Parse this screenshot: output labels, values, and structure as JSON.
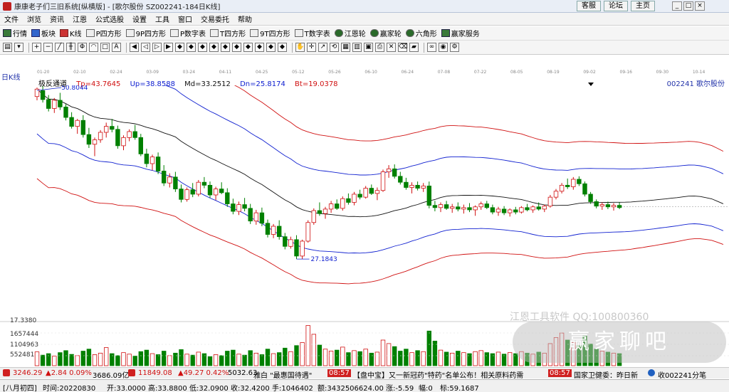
{
  "window": {
    "title": "康康老子们三旧系统[纵横版] - [歌尔股份  SZ002241-184日K线]"
  },
  "title_buttons": {
    "service": "客服",
    "forum": "论坛",
    "home": "主页"
  },
  "menu": [
    "文件",
    "浏览",
    "资讯",
    "江恩",
    "公式选股",
    "设置",
    "工具",
    "窗口",
    "交易委托",
    "帮助"
  ],
  "toolbar": [
    "行情",
    "板块",
    "K线",
    "P四方形",
    "9P四方形",
    "P数字表",
    "T四方形",
    "9T四方形",
    "T数字表",
    "江恩轮",
    "赢家轮",
    "六角形",
    "赢家服务"
  ],
  "chart_header": {
    "period": "日K线",
    "indicator_name": "极反通道",
    "tp": "Tp=43.7645",
    "up": "Up=38.8588",
    "md": "Md=33.2512",
    "dn": "Dn=25.8174",
    "bt": "Bt=19.0378",
    "stock": "002241  歌尔股份"
  },
  "date_axis": [
    "01-20",
    "02-10",
    "02-24",
    "03-09",
    "03-24",
    "04-11",
    "04-25",
    "05-12",
    "05-26",
    "06-10",
    "06-24",
    "07-08",
    "07-22",
    "08-05",
    "08-19",
    "09-02",
    "09-16",
    "09-30",
    "10-14"
  ],
  "volume_axis": [
    "17.3380",
    "1657444",
    "1104963",
    "552481"
  ],
  "watermark": {
    "line1": "江恩工具软件  QQ:100800360",
    "line2": "赢家聊吧"
  },
  "ticker": {
    "sh": "3246.29",
    "sh_change": "▲2.84 0.09%",
    "sh_amount": "3686.09亿",
    "sz": "11849.08",
    "sz_change": "▲49.27 0.42%",
    "sz_amount": "5032.63",
    "news1": "雅白  \"最惠国待遇\"",
    "time1": "08:57",
    "news2": "【盘中宝】又一新冠药\"特药\"名单公布！相关原料药需",
    "time2": "08:57",
    "news3": "国家卫健委：昨日新",
    "subscribed": "收002241分笔"
  },
  "status_bar": {
    "label": "[八月初四]",
    "time": "时间:20220830",
    "open": "开:33.0000",
    "high": "高:33.8800",
    "low": "低:32.0900",
    "close": "收:32.4200",
    "volume": "手:1046402",
    "amount": "额:3432506624.00",
    "change": "涨:-5.59",
    "amplitude": "幅:0",
    "target": "标:59.1687"
  },
  "chart_data": {
    "type": "candlestick",
    "annotations": [
      "50.8044",
      "27.1843"
    ],
    "bands": [
      "Tp",
      "Up",
      "Md",
      "Dn",
      "Bt"
    ],
    "price_axis_hint": [
      19,
      50
    ],
    "candles": [
      [
        49.0,
        50.2,
        48.5,
        50.0
      ],
      [
        49.8,
        50.4,
        48.2,
        48.6
      ],
      [
        48.6,
        49.2,
        47.0,
        47.4
      ],
      [
        47.4,
        48.8,
        46.8,
        48.5
      ],
      [
        48.5,
        49.5,
        47.2,
        47.6
      ],
      [
        47.6,
        48.0,
        45.8,
        46.2
      ],
      [
        46.2,
        46.9,
        44.7,
        45.0
      ],
      [
        45.0,
        46.0,
        44.0,
        45.8
      ],
      [
        45.8,
        46.5,
        43.5,
        43.9
      ],
      [
        43.9,
        44.8,
        42.1,
        42.6
      ],
      [
        42.6,
        43.5,
        41.0,
        43.2
      ],
      [
        43.2,
        44.5,
        42.8,
        44.2
      ],
      [
        44.2,
        45.5,
        43.5,
        45.0
      ],
      [
        45.0,
        46.0,
        44.2,
        44.6
      ],
      [
        44.6,
        45.1,
        42.0,
        42.4
      ],
      [
        42.4,
        43.8,
        41.8,
        43.5
      ],
      [
        43.5,
        44.6,
        43.0,
        44.3
      ],
      [
        44.3,
        45.2,
        43.2,
        43.5
      ],
      [
        43.5,
        44.0,
        41.0,
        41.3
      ],
      [
        41.3,
        42.0,
        39.5,
        40.0
      ],
      [
        40.0,
        41.2,
        39.1,
        40.9
      ],
      [
        40.9,
        41.5,
        38.6,
        39.0
      ],
      [
        39.0,
        39.8,
        37.0,
        37.4
      ],
      [
        37.4,
        38.7,
        36.8,
        38.2
      ],
      [
        38.2,
        38.9,
        36.2,
        36.6
      ],
      [
        36.6,
        37.2,
        34.8,
        35.2
      ],
      [
        35.2,
        36.8,
        34.9,
        36.5
      ],
      [
        36.5,
        37.4,
        35.5,
        35.9
      ],
      [
        35.9,
        37.8,
        35.6,
        37.5
      ],
      [
        37.5,
        38.2,
        36.7,
        37.1
      ],
      [
        37.1,
        37.6,
        35.4,
        35.8
      ],
      [
        35.8,
        36.9,
        35.1,
        36.6
      ],
      [
        36.6,
        37.5,
        35.9,
        36.1
      ],
      [
        36.1,
        36.7,
        34.2,
        34.6
      ],
      [
        34.6,
        35.3,
        33.2,
        33.6
      ],
      [
        33.6,
        34.9,
        33.1,
        34.5
      ],
      [
        34.5,
        35.4,
        33.6,
        34.0
      ],
      [
        34.0,
        34.6,
        31.9,
        32.3
      ],
      [
        32.3,
        33.8,
        31.8,
        33.4
      ],
      [
        33.4,
        34.1,
        31.6,
        32.0
      ],
      [
        32.0,
        32.5,
        30.1,
        30.5
      ],
      [
        30.5,
        31.9,
        30.0,
        31.6
      ],
      [
        31.6,
        32.4,
        29.8,
        30.2
      ],
      [
        30.2,
        30.7,
        28.5,
        28.9
      ],
      [
        28.9,
        30.2,
        28.6,
        29.8
      ],
      [
        29.8,
        30.4,
        27.2,
        27.6
      ],
      [
        27.6,
        29.8,
        27.2,
        29.6
      ],
      [
        29.6,
        32.4,
        29.4,
        32.1
      ],
      [
        32.1,
        34.0,
        31.8,
        33.7
      ],
      [
        33.7,
        34.8,
        33.0,
        33.3
      ],
      [
        33.3,
        34.2,
        32.6,
        33.9
      ],
      [
        33.9,
        35.0,
        33.4,
        34.6
      ],
      [
        34.6,
        35.2,
        33.8,
        34.0
      ],
      [
        34.0,
        35.6,
        33.7,
        35.3
      ],
      [
        35.3,
        36.0,
        34.5,
        34.8
      ],
      [
        34.8,
        36.2,
        34.4,
        35.9
      ],
      [
        35.9,
        36.5,
        35.2,
        35.5
      ],
      [
        35.5,
        37.0,
        35.3,
        36.7
      ],
      [
        36.7,
        37.2,
        35.8,
        36.0
      ],
      [
        36.0,
        36.8,
        35.1,
        36.4
      ],
      [
        36.4,
        39.2,
        36.2,
        38.9
      ],
      [
        38.9,
        39.8,
        38.1,
        39.3
      ],
      [
        39.3,
        39.9,
        38.0,
        38.3
      ],
      [
        38.3,
        38.9,
        37.2,
        37.5
      ],
      [
        37.5,
        38.1,
        36.5,
        36.8
      ],
      [
        36.8,
        37.5,
        36.0,
        37.1
      ],
      [
        37.1,
        37.6,
        36.4,
        36.7
      ],
      [
        36.7,
        37.4,
        36.2,
        37.0
      ],
      [
        37.0,
        37.6,
        34.0,
        34.4
      ],
      [
        34.4,
        35.0,
        33.6,
        34.1
      ],
      [
        34.1,
        34.8,
        33.5,
        34.5
      ],
      [
        34.5,
        35.0,
        33.8,
        34.0
      ],
      [
        34.0,
        34.6,
        33.4,
        34.2
      ],
      [
        34.2,
        34.8,
        33.6,
        33.9
      ],
      [
        33.9,
        34.5,
        33.3,
        34.1
      ],
      [
        34.1,
        34.7,
        33.5,
        33.8
      ],
      [
        33.8,
        34.4,
        33.0,
        34.2
      ],
      [
        34.2,
        34.9,
        33.8,
        34.6
      ],
      [
        34.6,
        35.0,
        33.9,
        34.1
      ],
      [
        34.1,
        34.5,
        33.2,
        33.5
      ],
      [
        33.5,
        34.2,
        33.0,
        33.9
      ],
      [
        33.9,
        34.3,
        33.1,
        33.4
      ],
      [
        33.4,
        34.0,
        32.9,
        33.8
      ],
      [
        33.8,
        34.2,
        33.2,
        33.5
      ],
      [
        33.5,
        34.3,
        33.3,
        34.1
      ],
      [
        34.1,
        34.6,
        33.6,
        33.8
      ],
      [
        33.8,
        34.4,
        33.4,
        34.2
      ],
      [
        34.2,
        34.8,
        33.7,
        33.9
      ],
      [
        33.9,
        34.5,
        33.5,
        34.3
      ],
      [
        34.3,
        35.8,
        34.1,
        35.5
      ],
      [
        35.5,
        36.6,
        35.2,
        36.3
      ],
      [
        36.3,
        37.4,
        36.0,
        37.1
      ],
      [
        37.1,
        38.0,
        36.6,
        36.9
      ],
      [
        36.9,
        38.2,
        36.5,
        37.9
      ],
      [
        37.9,
        38.3,
        37.0,
        37.3
      ],
      [
        37.3,
        37.6,
        35.6,
        35.9
      ],
      [
        35.9,
        36.2,
        34.6,
        34.9
      ],
      [
        34.9,
        35.2,
        34.0,
        34.3
      ],
      [
        34.3,
        34.8,
        33.8,
        34.5
      ],
      [
        34.5,
        34.9,
        33.9,
        34.2
      ],
      [
        34.2,
        34.7,
        33.7,
        34.4
      ],
      [
        34.4,
        34.8,
        33.9,
        34.1
      ]
    ],
    "volumes": [
      0.55,
      0.42,
      0.48,
      0.38,
      0.52,
      0.6,
      0.45,
      0.4,
      0.58,
      0.66,
      0.44,
      0.5,
      0.72,
      0.48,
      0.4,
      0.52,
      0.46,
      0.38,
      0.56,
      0.62,
      0.48,
      0.44,
      0.58,
      0.4,
      0.5,
      0.64,
      0.46,
      0.42,
      0.54,
      0.48,
      0.36,
      0.44,
      0.4,
      0.58,
      0.62,
      0.46,
      0.42,
      0.6,
      0.5,
      0.44,
      0.66,
      0.48,
      0.52,
      0.7,
      0.56,
      0.8,
      0.92,
      1.6,
      1.25,
      0.82,
      0.66,
      0.58,
      0.62,
      0.74,
      0.52,
      0.6,
      0.56,
      0.66,
      0.5,
      0.54,
      1.02,
      0.88,
      0.76,
      0.58,
      0.66,
      0.52,
      0.6,
      0.56,
      1.38,
      0.98,
      0.62,
      0.54,
      0.5,
      0.58,
      0.52,
      0.48,
      0.56,
      0.6,
      0.52,
      0.48,
      0.54,
      0.46,
      0.52,
      0.48,
      0.56,
      0.5,
      0.46,
      0.54,
      0.5,
      0.88,
      1.12,
      1.3,
      1.02,
      0.92,
      0.8,
      1.18,
      0.86,
      0.66,
      0.58,
      0.54,
      0.5,
      0.48
    ]
  }
}
